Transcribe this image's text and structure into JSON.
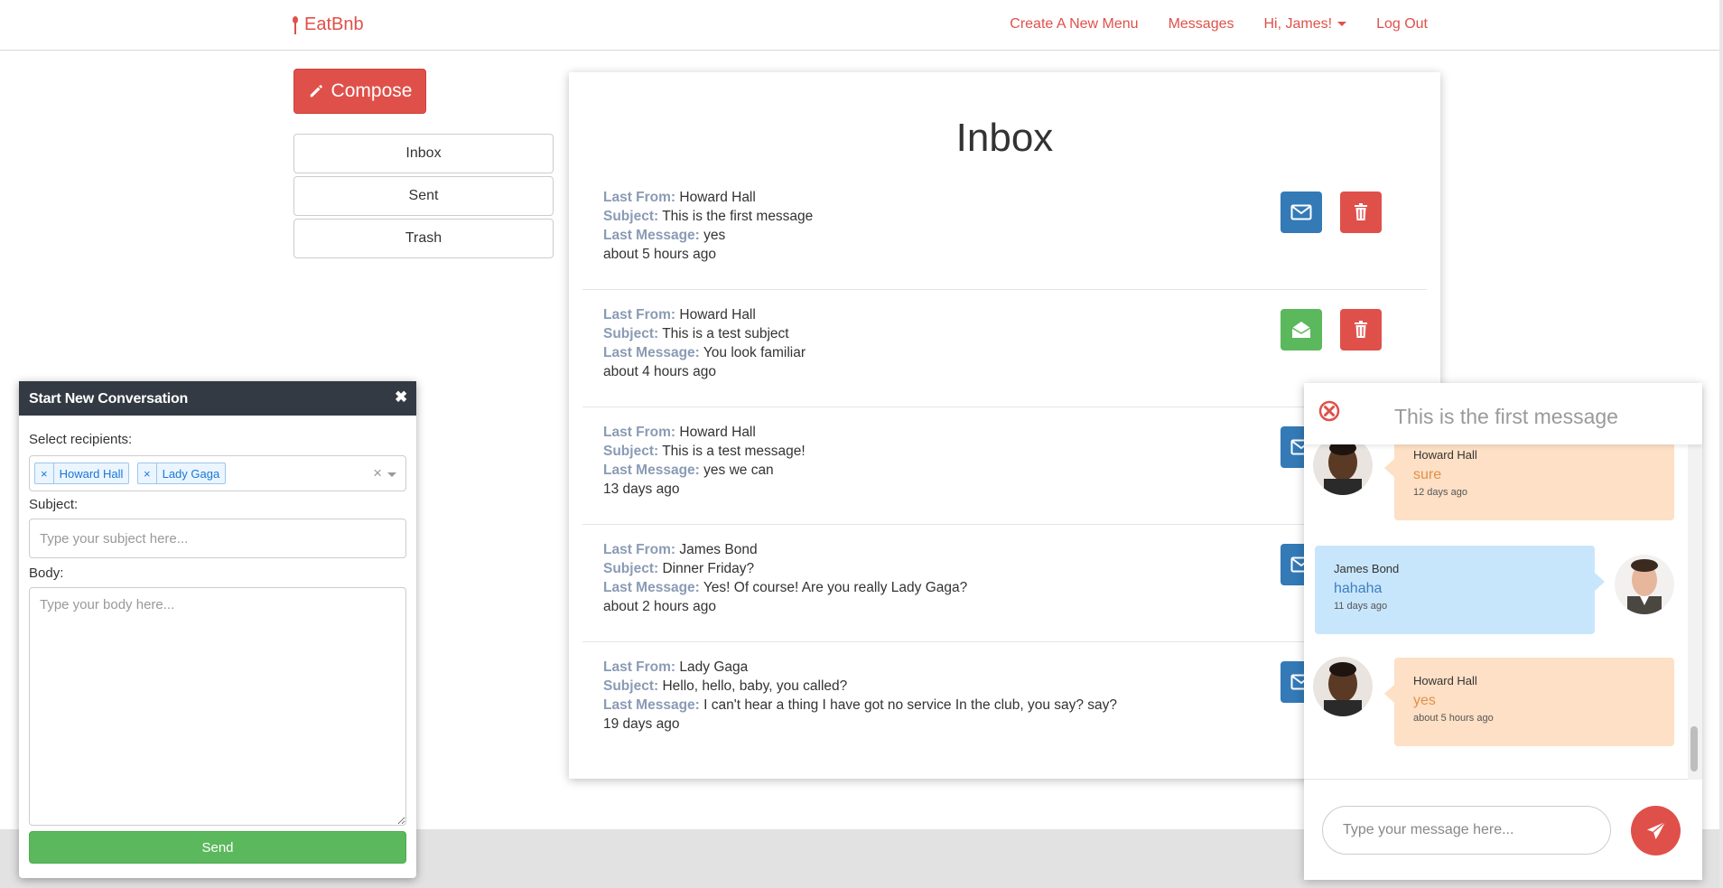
{
  "navbar": {
    "brand": "EatBnb",
    "links": {
      "create_menu": "Create A New Menu",
      "messages": "Messages",
      "user": "Hi, James!",
      "logout": "Log Out"
    }
  },
  "sidebar": {
    "compose_label": "Compose",
    "folders": [
      "Inbox",
      "Sent",
      "Trash"
    ]
  },
  "inbox": {
    "title": "Inbox",
    "labels": {
      "from": "Last From:",
      "subject": "Subject:",
      "message": "Last Message:"
    },
    "messages": [
      {
        "from": "Howard Hall",
        "subject": "This is the first message",
        "last_message": "yes",
        "time": "about 5 hours ago",
        "read": false
      },
      {
        "from": "Howard Hall",
        "subject": "This is a test subject",
        "last_message": "You look familiar",
        "time": "about 4 hours ago",
        "read": true
      },
      {
        "from": "Howard Hall",
        "subject": "This is a test message!",
        "last_message": "yes we can",
        "time": "13 days ago",
        "read": false
      },
      {
        "from": "James Bond",
        "subject": "Dinner Friday?",
        "last_message": "Yes! Of course! Are you really Lady Gaga?",
        "time": "about 2 hours ago",
        "read": false
      },
      {
        "from": "Lady Gaga",
        "subject": "Hello, hello, baby, you called?",
        "last_message": "I can't hear a thing I have got no service In the club, you say? say?",
        "time": "19 days ago",
        "read": false
      }
    ]
  },
  "composer": {
    "title": "Start New Conversation",
    "close_glyph": "✖",
    "recipients_label": "Select recipients:",
    "recipients": [
      "Howard Hall",
      "Lady Gaga"
    ],
    "tag_remove_glyph": "×",
    "clear_glyph": "×",
    "subject_label": "Subject:",
    "subject_placeholder": "Type your subject here...",
    "body_label": "Body:",
    "body_placeholder": "Type your body here...",
    "send_label": "Send"
  },
  "chat": {
    "title": "This is the first message",
    "messages": [
      {
        "sender": "Howard Hall",
        "text": "sure",
        "time": "12 days ago",
        "side": "left"
      },
      {
        "sender": "James Bond",
        "text": "hahaha",
        "time": "11 days ago",
        "side": "right"
      },
      {
        "sender": "Howard Hall",
        "text": "yes",
        "time": "about 5 hours ago",
        "side": "left"
      }
    ],
    "input_placeholder": "Type your message here..."
  },
  "colors": {
    "brand": "#e0504a",
    "primary": "#337ab7",
    "success": "#5cb85c",
    "dark_header": "#343a43",
    "label_muted": "#8a9bb5"
  },
  "icons": {
    "compose": "pencil-icon",
    "unread": "envelope-icon",
    "read": "envelope-open-icon",
    "delete": "trash-icon",
    "send": "paper-plane-icon",
    "close": "close-circle-icon"
  }
}
